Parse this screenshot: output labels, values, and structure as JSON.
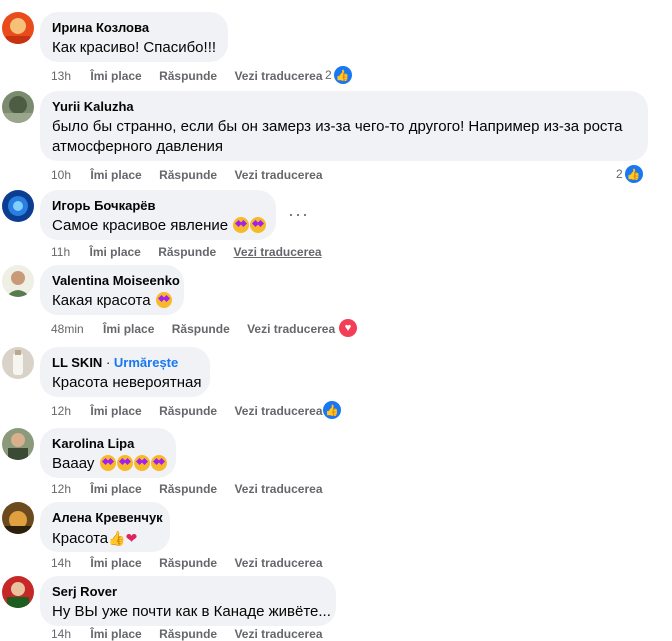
{
  "actions": {
    "like": "Îmi place",
    "reply": "Răspunde",
    "translate": "Vezi traducerea"
  },
  "comments": [
    {
      "author": "Ирина Козлова",
      "text": "Как красиво! Спасибо!!!",
      "time": "13h",
      "reactions": "2",
      "reaction_icon": "like-icon"
    },
    {
      "author": "Yurii Kaluzha",
      "text_line1": "было бы странно, если бы он замерз из-за чего-то другого! Например из-за роста",
      "text_line2": "атмосферного давления",
      "time": "10h",
      "reactions": "2",
      "reaction_icon": "like-icon"
    },
    {
      "author": "Игорь Бочкарёв",
      "text": "Самое красивое явление",
      "time": "11h",
      "emoji": "star-struck-emoji"
    },
    {
      "author": "Valentina Moiseenko",
      "text": "Какая красота",
      "time": "48min",
      "reaction_icon": "love-icon",
      "emoji": "star-struck-emoji"
    },
    {
      "author": "LL SKIN",
      "follow": "Urmărește",
      "separator": "·",
      "text": "Красота невероятная",
      "time": "12h",
      "reaction_icon": "like-icon"
    },
    {
      "author": "Karolina Lipa",
      "text": "Вааау",
      "time": "12h",
      "emoji": "star-struck-emoji x4"
    },
    {
      "author": "Алена Кревенчук",
      "text": "Красота",
      "time": "14h",
      "emoji": "thumbs-up, heart"
    },
    {
      "author": "Serj Rover",
      "text": "Ну ВЫ уже почти как в Канаде живёте...",
      "time": "14h"
    }
  ],
  "colors": {
    "bubble": "#f0f2f5",
    "meta": "#65676b",
    "accent": "#1877f2",
    "love": "#f33e58"
  }
}
